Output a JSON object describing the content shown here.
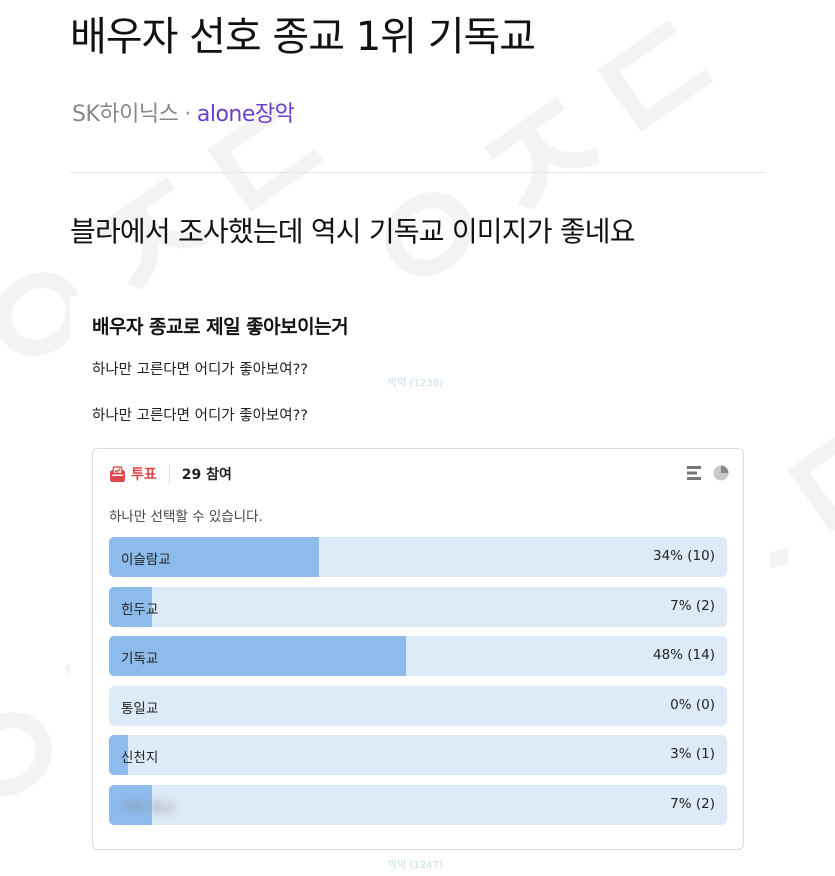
{
  "post": {
    "title": "배우자 선호 종교 1위 기독교",
    "company": "SK하이닉스",
    "separator": "·",
    "author": "alone장악",
    "body": "블라에서 조사했는데 역시 기독교 이미지가 좋네요"
  },
  "embed": {
    "title": "배우자 종교로 제일 좋아보이는거",
    "line1": "하나만 고른다면 어디가 좋아보여??",
    "line2": "하나만 고른다면 어디가 좋아보여??",
    "watermark_small_1": "박박 (1238)",
    "watermark_small_2": "박박 (1247)",
    "poll": {
      "tag_label": "투표",
      "participants": "29 참여",
      "description": "하나만 선택할 수 있습니다.",
      "accent_color": "#e0474c",
      "bar_color": "#8dbcec",
      "track_color": "#ddeaf8",
      "icons": [
        "vote-box-icon",
        "bar-chart-icon",
        "pie-chart-icon"
      ],
      "options": [
        {
          "label": "이슬람교",
          "result": "34% (10)",
          "percent": 34
        },
        {
          "label": "힌두교",
          "result": "7% (2)",
          "percent": 7
        },
        {
          "label": "기독교",
          "result": "48% (14)",
          "percent": 48
        },
        {
          "label": "통일교",
          "result": "0% (0)",
          "percent": 0
        },
        {
          "label": "신천지",
          "result": "3% (1)",
          "percent": 3
        },
        {
          "label": "기타 종교",
          "result": "7% (2)",
          "percent": 7
        }
      ]
    }
  }
}
